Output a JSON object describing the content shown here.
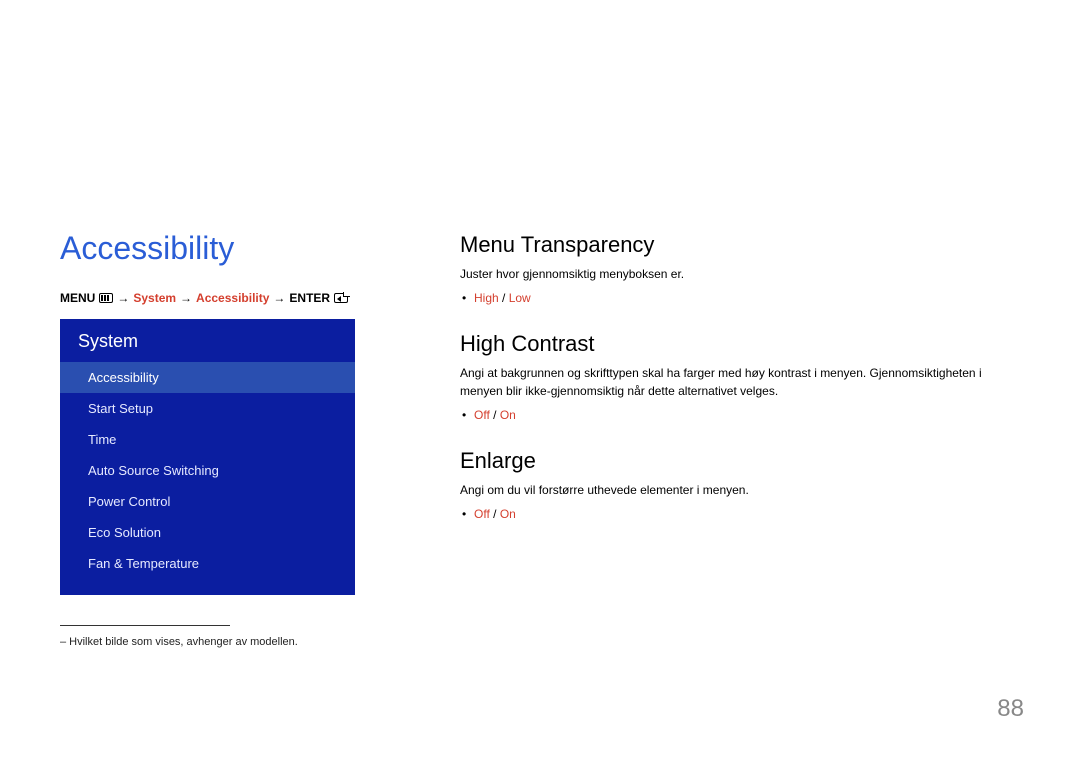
{
  "page_title": "Accessibility",
  "breadcrumb": {
    "menu_label": "MENU",
    "arrow": "→",
    "system": "System",
    "accessibility": "Accessibility",
    "enter_label": "ENTER"
  },
  "menu": {
    "header": "System",
    "items": [
      {
        "label": "Accessibility",
        "selected": true
      },
      {
        "label": "Start Setup",
        "selected": false
      },
      {
        "label": "Time",
        "selected": false
      },
      {
        "label": "Auto Source Switching",
        "selected": false
      },
      {
        "label": "Power Control",
        "selected": false
      },
      {
        "label": "Eco Solution",
        "selected": false
      },
      {
        "label": "Fan & Temperature",
        "selected": false
      }
    ]
  },
  "footnote": "– Hvilket bilde som vises, avhenger av modellen.",
  "sections": [
    {
      "title": "Menu Transparency",
      "body": "Juster hvor gjennomsiktig menyboksen er.",
      "options": {
        "a": "High",
        "sep": " / ",
        "b": "Low"
      }
    },
    {
      "title": "High Contrast",
      "body": "Angi at bakgrunnen og skrifttypen skal ha farger med høy kontrast i menyen. Gjennomsiktigheten i menyen blir ikke-gjennomsiktig når dette alternativet velges.",
      "options": {
        "a": "Off",
        "sep": " / ",
        "b": "On"
      }
    },
    {
      "title": "Enlarge",
      "body": "Angi om du vil forstørre uthevede elementer i menyen.",
      "options": {
        "a": "Off",
        "sep": " / ",
        "b": "On"
      }
    }
  ],
  "page_number": "88"
}
